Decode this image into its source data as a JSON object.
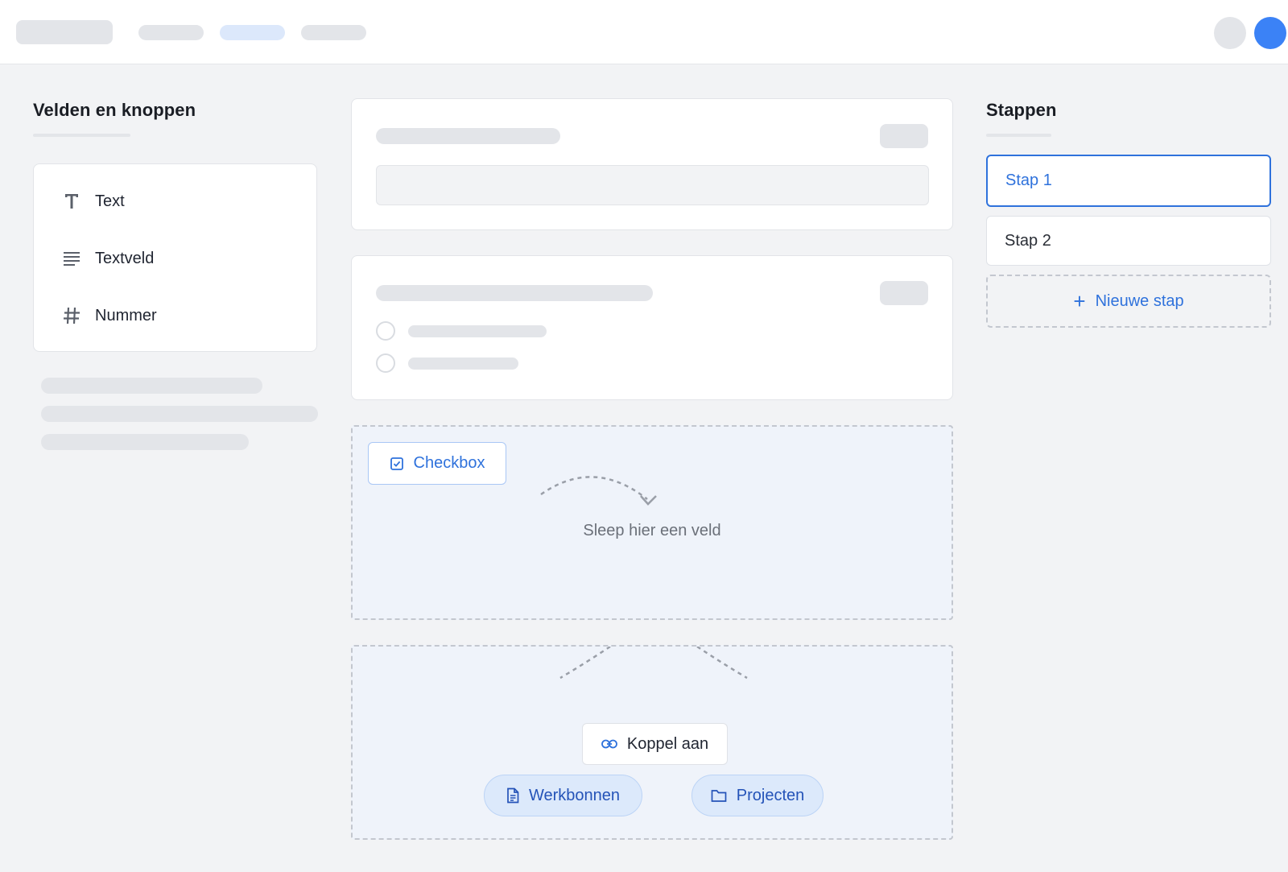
{
  "palette": {
    "title": "Velden en knoppen",
    "items": [
      {
        "label": "Text",
        "icon": "text-type-icon"
      },
      {
        "label": "Textveld",
        "icon": "lines-icon"
      },
      {
        "label": "Nummer",
        "icon": "hash-icon"
      }
    ]
  },
  "canvas": {
    "dragged_chip": {
      "label": "Checkbox",
      "icon": "checkbox-icon"
    },
    "drop_hint": "Sleep hier een veld",
    "link": {
      "label": "Koppel aan",
      "icon": "link-icon",
      "targets": [
        {
          "label": "Werkbonnen",
          "icon": "document-icon"
        },
        {
          "label": "Projecten",
          "icon": "folder-icon"
        }
      ]
    }
  },
  "steps": {
    "title": "Stappen",
    "items": [
      {
        "label": "Stap 1",
        "active": true
      },
      {
        "label": "Stap 2",
        "active": false
      }
    ],
    "add_label": "Nieuwe stap"
  },
  "colors": {
    "accent": "#2f72dc",
    "avatar": "#3b82f6",
    "skeleton": "#e3e5e9",
    "dropzone_bg": "#eff3fa"
  }
}
